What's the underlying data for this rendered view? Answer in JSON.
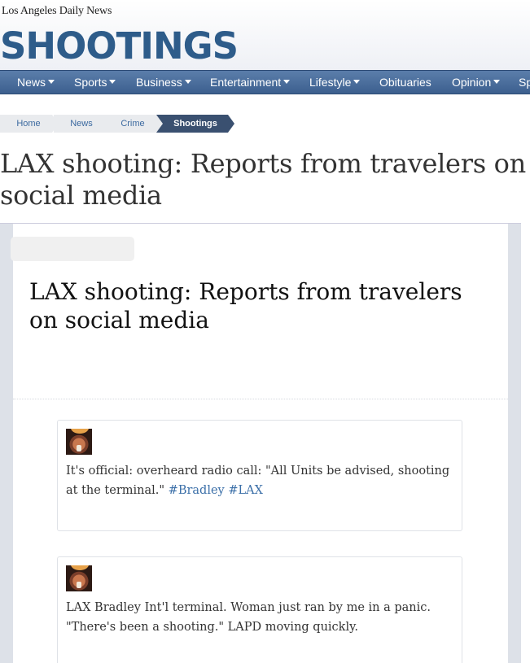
{
  "header": {
    "paper_name": "Los Angeles Daily News",
    "section_title": "SHOOTINGS"
  },
  "nav": {
    "items": [
      {
        "label": "News",
        "has_caret": true
      },
      {
        "label": "Sports",
        "has_caret": true
      },
      {
        "label": "Business",
        "has_caret": true
      },
      {
        "label": "Entertainment",
        "has_caret": true
      },
      {
        "label": "Lifestyle",
        "has_caret": true
      },
      {
        "label": "Obituaries",
        "has_caret": false
      },
      {
        "label": "Opinion",
        "has_caret": true
      },
      {
        "label": "Sp",
        "has_caret": false
      }
    ]
  },
  "breadcrumb": {
    "items": [
      "Home",
      "News",
      "Crime",
      "Shootings"
    ],
    "active_index": 3
  },
  "article": {
    "headline": "LAX shooting: Reports from travelers on social media"
  },
  "embed": {
    "title": "LAX shooting: Reports from travelers on social media",
    "posts": [
      {
        "text": "It's official: overheard radio call: \"All Units be advised, shooting at the terminal.\"",
        "hashtags": [
          "#Bradley",
          "#LAX"
        ]
      },
      {
        "text": "LAX Bradley Int'l terminal. Woman just ran by me in a panic. \"There's been a shooting.\" LAPD moving quickly.",
        "hashtags": []
      }
    ]
  },
  "colors": {
    "brand_blue": "#2e5c8a",
    "nav_bg": "#4a6d9c",
    "breadcrumb_active": "#3a5070",
    "hashtag": "#3b6fa8"
  }
}
